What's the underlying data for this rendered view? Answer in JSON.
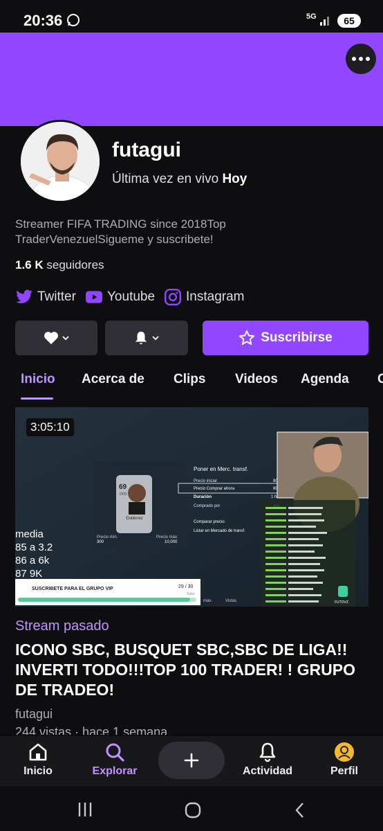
{
  "status_bar": {
    "time": "20:36",
    "network": "5G",
    "battery": "65"
  },
  "profile": {
    "username": "futagui",
    "last_live_prefix": "Última vez en vivo",
    "last_live_value": "Hoy",
    "bio": "Streamer FIFA TRADING since 2018Top TraderVenezuelSigueme y suscribete!",
    "followers_count": "1.6 K",
    "followers_label": "seguidores"
  },
  "social": {
    "twitter": "Twitter",
    "youtube": "Youtube",
    "instagram": "Instagram"
  },
  "actions": {
    "subscribe": "Suscribirse"
  },
  "tabs": [
    {
      "label": "Inicio"
    },
    {
      "label": "Acerca de"
    },
    {
      "label": "Clips"
    },
    {
      "label": "Videos"
    },
    {
      "label": "Agenda"
    },
    {
      "label": "C"
    }
  ],
  "video": {
    "duration": "3:05:10",
    "overlay_lines": [
      "media",
      "85 a 3.2",
      "86 a 6k",
      "87 9K"
    ],
    "overlay_menu_title": "Poner en Merc. transf.",
    "overlay_menu": [
      "Precio inicial",
      "Precio Comprar ahora",
      "Duración",
      "Comprado por",
      "Comparar precio",
      "Listar en Mercado de transf."
    ],
    "overlay_menu_values": [
      "80",
      "80",
      "1 ho",
      "400"
    ],
    "card_rating": "69",
    "card_pos": "DFD",
    "card_name": "Gutiérrez",
    "price_min_label": "Precio mín.",
    "price_min": "300",
    "price_max_label": "Precio máx.",
    "price_max": "10,000",
    "vip_banner": "SUSCRIBETE PARA EL GRUPO VIP",
    "vip_count": "29 / 30",
    "vip_unit": "Subs",
    "views_hint": "máx.",
    "views_hint2": "Vistas",
    "logo_text": "FUTOVZ",
    "label": "Stream pasado",
    "title": "ICONO SBC, BUSQUET SBC,SBC DE LIGA!! INVERTI TODO!!!TOP 100 TRADER! ! GRUPO DE TRADEO!",
    "channel": "futagui",
    "meta": "244 vistas · hace 1 semana"
  },
  "bottom_nav": [
    {
      "label": "Inicio",
      "icon": "home-icon"
    },
    {
      "label": "Explorar",
      "icon": "search-icon"
    },
    {
      "label": "Actividad",
      "icon": "bell-icon"
    },
    {
      "label": "Perfil",
      "icon": "avatar-icon"
    }
  ],
  "colors": {
    "accent": "#9147ff",
    "accent_light": "#bf94ff",
    "background": "#0e0e10",
    "button": "#2f2f35"
  }
}
